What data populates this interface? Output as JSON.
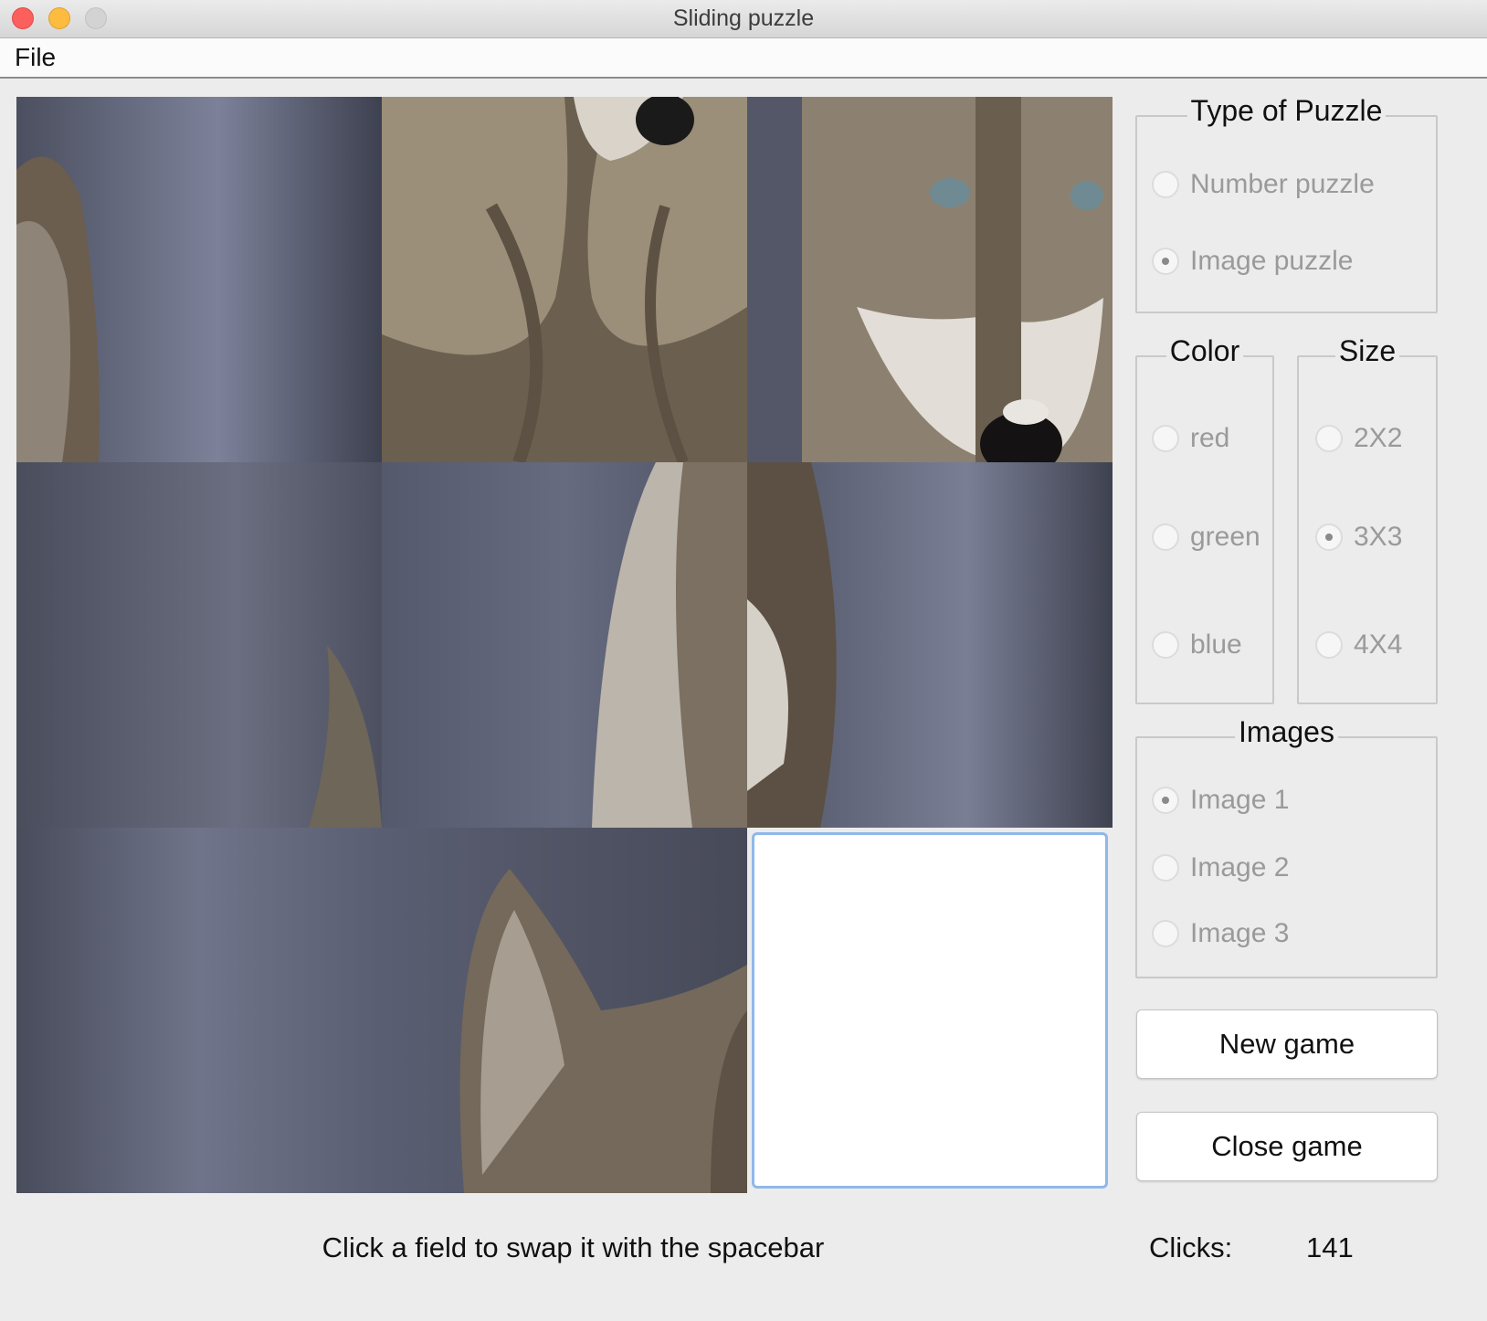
{
  "window": {
    "title": "Sliding puzzle"
  },
  "menubar": {
    "file": "File"
  },
  "board": {
    "tiles": [
      {
        "label": "wolf-left-ear"
      },
      {
        "label": "wolf-nose-closeup"
      },
      {
        "label": "wolf-face"
      },
      {
        "label": "background"
      },
      {
        "label": "wolf-neck-edge"
      },
      {
        "label": "wolf-shoulder"
      },
      {
        "label": "background-bottom"
      },
      {
        "label": "wolf-ears"
      },
      {
        "label": "empty"
      }
    ]
  },
  "type_of_puzzle": {
    "title": "Type of Puzzle",
    "options": [
      {
        "label": "Number puzzle",
        "selected": false
      },
      {
        "label": "Image puzzle",
        "selected": true
      }
    ]
  },
  "color": {
    "title": "Color",
    "options": [
      {
        "label": "red",
        "selected": false
      },
      {
        "label": "green",
        "selected": false
      },
      {
        "label": "blue",
        "selected": false
      }
    ]
  },
  "size": {
    "title": "Size",
    "options": [
      {
        "label": "2X2",
        "selected": false
      },
      {
        "label": "3X3",
        "selected": true
      },
      {
        "label": "4X4",
        "selected": false
      }
    ]
  },
  "images": {
    "title": "Images",
    "options": [
      {
        "label": "Image 1",
        "selected": true
      },
      {
        "label": "Image 2",
        "selected": false
      },
      {
        "label": "Image 3",
        "selected": false
      }
    ]
  },
  "buttons": {
    "new_game": "New game",
    "close_game": "Close game"
  },
  "status": {
    "message": "Click a field to swap it with the spacebar",
    "clicks_label": "Clicks:",
    "clicks_value": "141"
  }
}
